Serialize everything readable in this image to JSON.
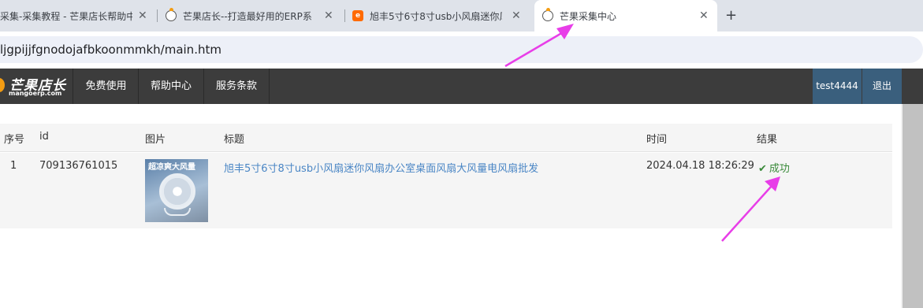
{
  "browser": {
    "tabs": [
      {
        "title": "采集-采集教程 - 芒果店长帮助中",
        "favicon": "none"
      },
      {
        "title": "芒果店长--打造最好用的ERP系",
        "favicon": "mango-icon"
      },
      {
        "title": "旭丰5寸6寸8寸usb小风扇迷你风",
        "favicon": "1688-icon"
      },
      {
        "title": "芒果采集中心",
        "favicon": "mango-icon",
        "active": true
      }
    ],
    "close_glyph": "✕",
    "new_tab_glyph": "+",
    "url": "ljgpijjfgnodojafbkoonmmkh/main.htm"
  },
  "nav": {
    "logo_name": "芒果店长",
    "logo_sub": "mangoerp.com",
    "links": [
      "免费使用",
      "帮助中心",
      "服务条款"
    ],
    "user": "test4444",
    "logout": "退出"
  },
  "table": {
    "headers": [
      "序号",
      "id",
      "图片",
      "标题",
      "时间",
      "结果"
    ],
    "rows": [
      {
        "index": "1",
        "id": "709136761015",
        "image_caption": "超凉爽大风量",
        "title": "旭丰5寸6寸8寸usb小风扇迷你风扇办公室桌面风扇大风量电风扇批发",
        "time": "2024.04.18 18:26:29",
        "result": "成功"
      }
    ]
  },
  "colors": {
    "nav_bg": "#3c3c3c",
    "user_bg": "#3a5f7d",
    "link": "#4a86c5",
    "success": "#3a8a3a",
    "arrow": "#e83ee8"
  }
}
